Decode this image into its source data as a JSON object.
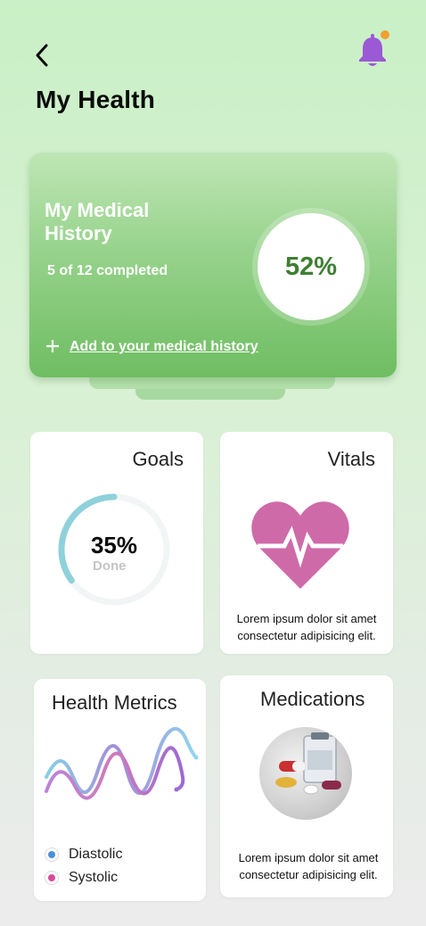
{
  "header": {
    "title": "My Health",
    "back_icon": "chevron-left-icon",
    "notification_icon": "bell-icon",
    "bell_color": "#9b59d6",
    "badge_color": "#f0a030"
  },
  "medical_history": {
    "title": "My Medical History",
    "progress_text": "5 of 12 completed",
    "percent_text": "52%",
    "percent_value": 0.52,
    "add_link": "Add to your medical history",
    "add_icon": "plus-icon"
  },
  "goals": {
    "title": "Goals",
    "value_text": "35%",
    "sub_label": "Done",
    "progress": 0.35,
    "ring_color": "#8fd1da"
  },
  "vitals": {
    "title": "Vitals",
    "icon": "heartbeat-icon",
    "icon_color": "#cf6aa8",
    "description": "Lorem ipsum dolor sit amet consectetur adipisicing  elit."
  },
  "health_metrics": {
    "title": "Health Metrics",
    "legend": [
      {
        "label": "Diastolic",
        "color": "#4a90d9"
      },
      {
        "label": "Systolic",
        "color": "#d64a9a"
      }
    ]
  },
  "medications": {
    "title": "Medications",
    "description": "Lorem ipsum dolor sit amet consectetur adipisicing  elit."
  }
}
